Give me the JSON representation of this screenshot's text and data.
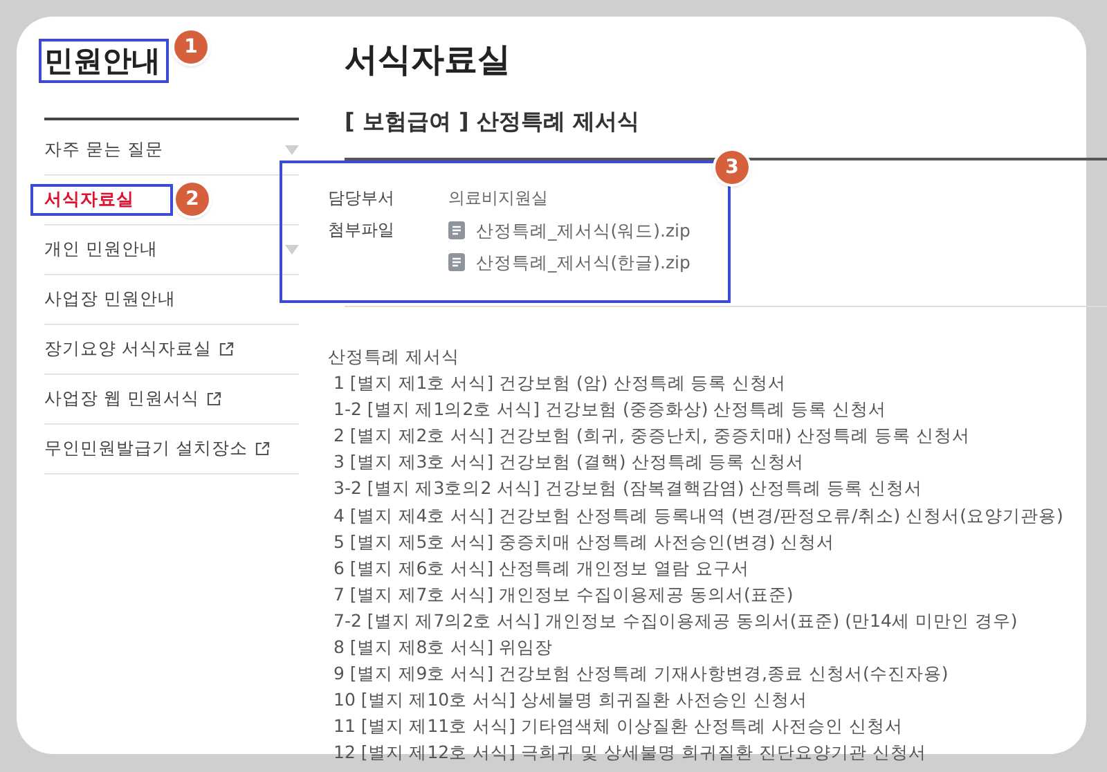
{
  "sidebar": {
    "title": "민원안내",
    "callout": "1",
    "items": [
      {
        "label": "자주 묻는 질문",
        "kind": "dropdown",
        "selected": false
      },
      {
        "label": "서식자료실",
        "kind": "plain",
        "selected": true,
        "callout": "2"
      },
      {
        "label": "개인 민원안내",
        "kind": "dropdown",
        "selected": false
      },
      {
        "label": "사업장 민원안내",
        "kind": "plain",
        "selected": false
      },
      {
        "label": "장기요양 서식자료실",
        "kind": "external",
        "selected": false
      },
      {
        "label": "사업장 웹 민원서식",
        "kind": "external",
        "selected": false
      },
      {
        "label": "무인민원발급기 설치장소",
        "kind": "external",
        "selected": false
      }
    ]
  },
  "page": {
    "title": "서식자료실"
  },
  "post": {
    "title": "[ 보험급여 ] 산정특례 제서식",
    "callout": "3",
    "department": {
      "label": "담당부서",
      "value": "의료비지원실"
    },
    "attachments": {
      "label": "첨부파일",
      "files": [
        "산정특례_제서식(워드).zip",
        "산정특례_제서식(한글).zip"
      ]
    },
    "body": {
      "heading": "산정특례 제서식",
      "lines": [
        "1 [별지 제1호 서식] 건강보험 (암) 산정특례 등록 신청서",
        "1-2 [별지 제1의2호 서식] 건강보험 (중증화상) 산정특례 등록 신청서",
        "2 [별지 제2호 서식] 건강보험 (희귀, 중증난치, 중증치매) 산정특례 등록 신청서",
        "3 [별지 제3호 서식] 건강보험 (결핵) 산정특례 등록 신청서",
        "3-2 [별지 제3호의2 서식] 건강보험 (잠복결핵감염) 산정특례 등록 신청서",
        "4 [별지 제4호 서식] 건강보험 산정특례 등록내역 (변경/판정오류/취소) 신청서(요양기관용)",
        "5 [별지 제5호 서식] 중증치매 산정특례 사전승인(변경) 신청서",
        "6 [별지 제6호 서식] 산정특례 개인정보 열람 요구서",
        "7 [별지 제7호 서식] 개인정보 수집이용제공 동의서(표준)",
        "7-2 [별지 제7의2호 서식] 개인정보 수집이용제공 동의서(표준) (만14세 미만인 경우)",
        "8 [별지 제8호 서식] 위임장",
        "9 [별지 제9호 서식] 건강보험 산정특례 기재사항변경,종료 신청서(수진자용)",
        "10 [별지 제10호 서식] 상세불명 희귀질환 사전승인 신청서",
        "11 [별지 제11호 서식] 기타염색체 이상질환 산정특례 사전승인 신청서",
        "12 [별지 제12호 서식] 극희귀 및 상세불명 희귀질환 진단요양기관 신청서"
      ]
    }
  }
}
